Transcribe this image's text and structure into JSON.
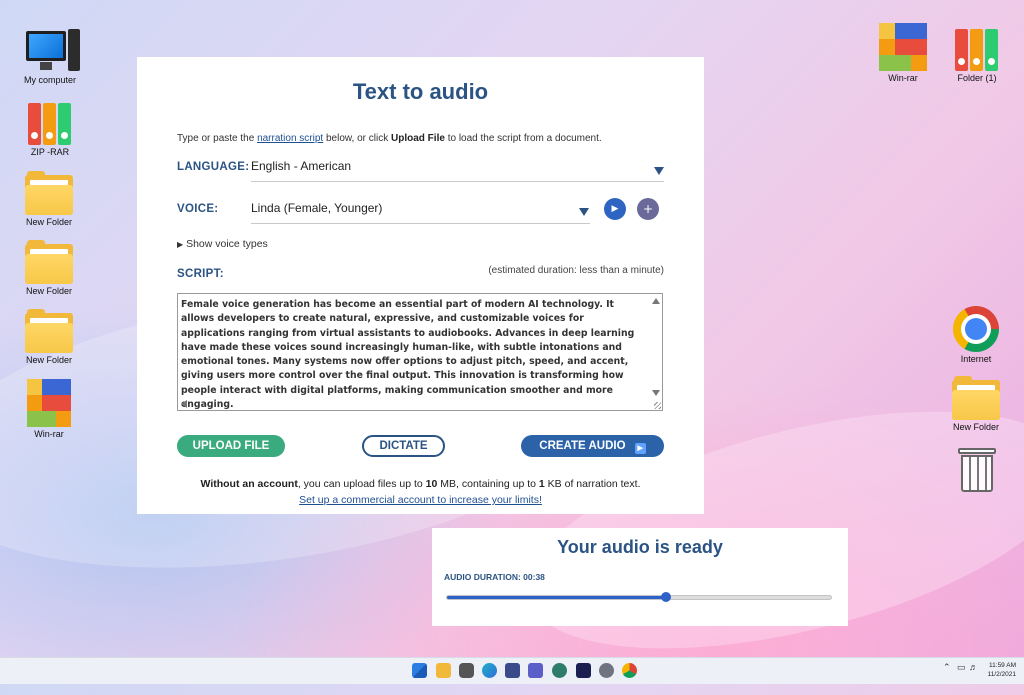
{
  "desktop": {
    "left_icons": [
      {
        "label": "My computer",
        "icon": "computer-icon"
      },
      {
        "label": "ZIP -RAR",
        "icon": "binders-icon"
      },
      {
        "label": "New Folder",
        "icon": "folder-icon"
      },
      {
        "label": "New Folder",
        "icon": "folder-icon"
      },
      {
        "label": "New Folder",
        "icon": "folder-icon"
      },
      {
        "label": "Win-rar",
        "icon": "winrar-icon"
      }
    ],
    "right_icons": [
      {
        "label": "Win-rar",
        "icon": "winrar-icon"
      },
      {
        "label": "Folder (1)",
        "icon": "binders-icon"
      },
      {
        "label": "Internet",
        "icon": "chrome-icon"
      },
      {
        "label": "New Folder",
        "icon": "folder-icon"
      },
      {
        "label": "",
        "icon": "recycle-bin-icon"
      }
    ]
  },
  "tts": {
    "title": "Text to audio",
    "intro_before": "Type or paste the ",
    "intro_link": "narration script",
    "intro_middle": " below, or click ",
    "intro_bold": "Upload File",
    "intro_after": " to load the script from a document.",
    "language_label": "LANGUAGE:",
    "language_value": "English - American",
    "voice_label": "VOICE:",
    "voice_value": "Linda (Female, Younger)",
    "show_voice_types": "Show voice types",
    "script_label": "SCRIPT:",
    "duration_note": "(estimated duration: less than a minute)",
    "script_text": "Female voice generation has become an essential part of modern AI technology. It allows developers to create natural, expressive, and customizable voices for applications ranging from virtual assistants to audiobooks. Advances in deep learning have made these voices sound increasingly human-like, with subtle intonations and emotional tones. Many systems now offer options to adjust pitch, speed, and accent, giving users more control over the final output. This innovation is transforming how people interact with digital platforms, making communication smoother and more engaging.",
    "upload_button": "UPLOAD FILE",
    "dictate_button": "DICTATE",
    "create_button": "CREATE AUDIO",
    "limits_1": "Without an account",
    "limits_2": ", you can upload files up to ",
    "limits_3": "10",
    "limits_4": " MB, containing up to ",
    "limits_5": "1",
    "limits_6": " KB of narration text.",
    "commercial_link": "Set up a commercial account to increase your limits!"
  },
  "audio": {
    "title": "Your audio is ready",
    "duration_label": "AUDIO DURATION: 00:38",
    "progress": 0.57
  },
  "taskbar": {
    "time": "11:59 AM",
    "date": "11/2/2021"
  },
  "colors": {
    "accent": "#2b5383",
    "upload_green": "#3aaa7f",
    "create_blue": "#2b62a8",
    "play_blue": "#2e64c2",
    "add_purple": "#6a6a9a"
  }
}
